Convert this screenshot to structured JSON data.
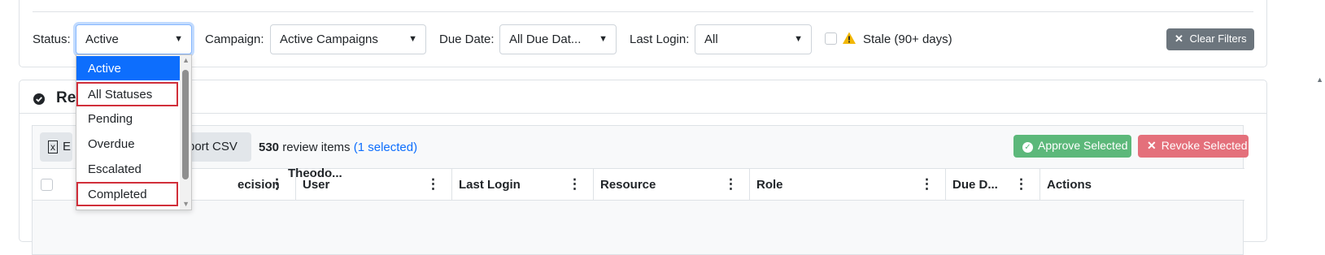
{
  "filters": {
    "status_label": "Status:",
    "status_value": "Active",
    "campaign_label": "Campaign:",
    "campaign_value": "Active Campaigns",
    "due_date_label": "Due Date:",
    "due_date_value": "All Due Dat...",
    "last_login_label": "Last Login:",
    "last_login_value": "All",
    "stale_label": "Stale (90+ days)",
    "stale_checked": false,
    "clear_label": "Clear Filters"
  },
  "status_dropdown": {
    "options": [
      "Active",
      "All Statuses",
      "Pending",
      "Overdue",
      "Escalated",
      "Completed"
    ],
    "selected": "Active",
    "highlighted": [
      "All Statuses",
      "Completed"
    ]
  },
  "review": {
    "title": "Rev",
    "export_label": "E",
    "export_csv_label": "port CSV",
    "item_count": "530",
    "items_suffix": " review items ",
    "selected_text": "(1 selected)",
    "approve_label": "Approve Selected",
    "revoke_label": "Revoke Selected",
    "columns": [
      "Decision",
      "User",
      "Last Login",
      "Resource",
      "Role",
      "Due D...",
      "Actions"
    ],
    "columns_visible": [
      "ecision",
      "User",
      "Last Login",
      "Resource",
      "Role",
      "Due D...",
      "Actions"
    ],
    "first_row_partial": "Theodo..."
  },
  "colors": {
    "primary": "#0d6efd",
    "secondary": "#6c757d",
    "success": "#5cb87a",
    "danger": "#e4707b",
    "highlight_box": "#d12f3a"
  }
}
